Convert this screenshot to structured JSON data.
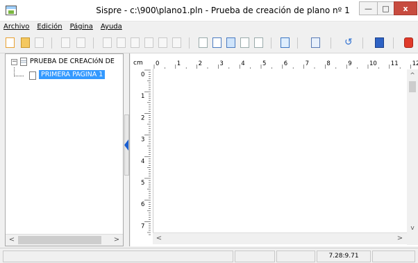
{
  "window": {
    "title": "Sispre - c:\\900\\plano1.pln - Prueba de creación de plano nº 1",
    "minimize_glyph": "—",
    "maximize_glyph": "□",
    "close_glyph": "x"
  },
  "menu": {
    "items": [
      {
        "label": "Archivo"
      },
      {
        "label": "Edición"
      },
      {
        "label": "Página"
      },
      {
        "label": "Ayuda"
      }
    ]
  },
  "tree": {
    "root_label": "PRUEBA DE CREACIóN DE",
    "child_label": "PRIMERA PAGINA 1",
    "toggle_glyph": "−"
  },
  "scroll": {
    "left_arrow": "<",
    "right_arrow": ">",
    "up_arrow": "^",
    "down_arrow": "v"
  },
  "ruler": {
    "unit": "cm",
    "h_labels": [
      "0",
      "1",
      "2",
      "3",
      "4",
      "5",
      "6",
      "7",
      "8",
      "9",
      "10",
      "11",
      "12"
    ],
    "v_labels": [
      "0",
      "1",
      "2",
      "3",
      "4",
      "5",
      "6",
      "7"
    ]
  },
  "status": {
    "coords": "7.28:9.71"
  },
  "colors": {
    "selection": "#3399ff",
    "close_button": "#c74b3f",
    "splitter_arrow": "#1a5fd1"
  }
}
